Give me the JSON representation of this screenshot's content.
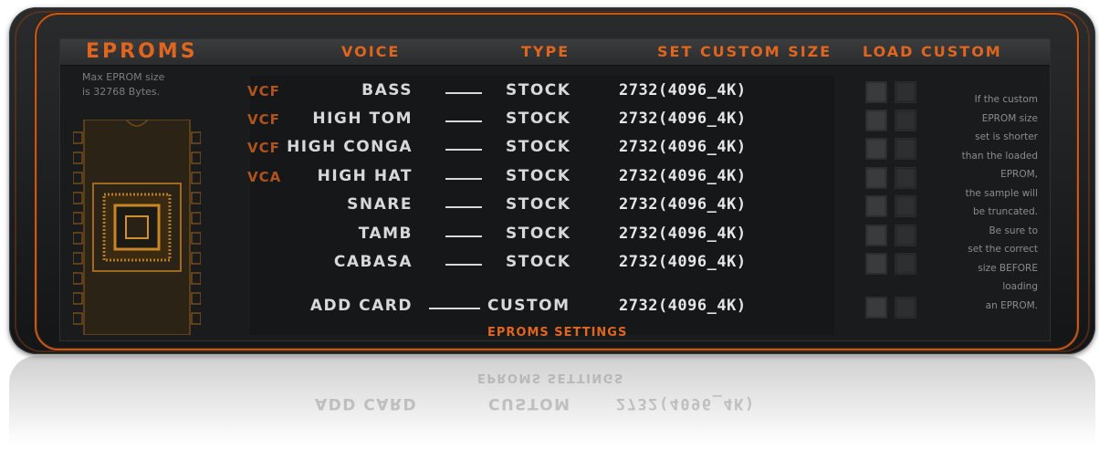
{
  "panel": {
    "title": "EPROMS",
    "max_note": "Max EPROM size\nis 32768 Bytes.",
    "headers": {
      "voice": "VOICE",
      "type": "TYPE",
      "size": "SET CUSTOM SIZE",
      "load": "LOAD CUSTOM"
    },
    "rows": [
      {
        "filter": "VCF",
        "voice": "BASS",
        "type": "STOCK",
        "size": "2732(4096_4K)"
      },
      {
        "filter": "VCF",
        "voice": "HIGH TOM",
        "type": "STOCK",
        "size": "2732(4096_4K)"
      },
      {
        "filter": "VCF",
        "voice": "HIGH CONGA",
        "type": "STOCK",
        "size": "2732(4096_4K)"
      },
      {
        "filter": "VCA",
        "voice": "HIGH HAT",
        "type": "STOCK",
        "size": "2732(4096_4K)"
      },
      {
        "filter": "",
        "voice": "SNARE",
        "type": "STOCK",
        "size": "2732(4096_4K)"
      },
      {
        "filter": "",
        "voice": "TAMB",
        "type": "STOCK",
        "size": "2732(4096_4K)"
      },
      {
        "filter": "",
        "voice": "CABASA",
        "type": "STOCK",
        "size": "2732(4096_4K)"
      },
      {
        "filter": "",
        "voice": "ADD CARD",
        "type": "CUSTOM",
        "size": "2732(4096_4K)"
      }
    ],
    "info_note": "If the custom\nEPROM size\nset is shorter\nthan the loaded\nEPROM,\nthe sample will\nbe truncated.\nBe sure to\nset the correct\nsize BEFORE\nloading\nan EPROM.",
    "footer": "EPROMS SETTINGS"
  },
  "reflection": {
    "footer": "EPROMS SETTINGS",
    "voice": "ADD CARD",
    "type": "CUSTOM",
    "size": "2732(4096_4K)"
  },
  "colors": {
    "accent_orange": "#e0651f",
    "panel_dark": "#1a1b1d",
    "text_light": "#d8d8d8"
  }
}
